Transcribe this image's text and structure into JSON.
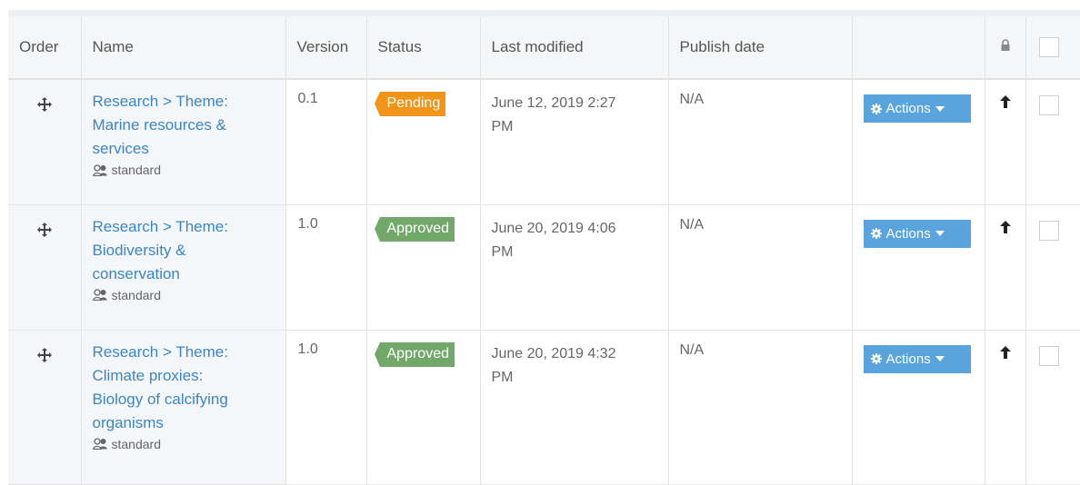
{
  "columns": {
    "order": "Order",
    "name": "Name",
    "version": "Version",
    "status": "Status",
    "last_modified": "Last modified",
    "publish_date": "Publish date"
  },
  "icons": {
    "move": "move-icon",
    "lock": "lock-icon",
    "users": "users-icon",
    "gear": "gear-icon",
    "caret": "caret-down-icon",
    "arrow_up": "arrow-up-icon"
  },
  "colors": {
    "pending": "#f0941a",
    "approved": "#72a96b",
    "action": "#5aa4de",
    "link": "#3a86c4"
  },
  "rows": [
    {
      "name_lines": [
        "Research > Theme:",
        "Marine resources &",
        "services"
      ],
      "template": "standard",
      "version": "0.1",
      "status": "Pending",
      "last_modified_lines": [
        "June 12, 2019 2:27",
        "PM"
      ],
      "publish_date": "N/A",
      "actions_label": "Actions"
    },
    {
      "name_lines": [
        "Research > Theme:",
        "Biodiversity &",
        "conservation"
      ],
      "template": "standard",
      "version": "1.0",
      "status": "Approved",
      "last_modified_lines": [
        "June 20, 2019 4:06",
        "PM"
      ],
      "publish_date": "N/A",
      "actions_label": "Actions"
    },
    {
      "name_lines": [
        "Research > Theme:",
        "Climate proxies:",
        "Biology of calcifying",
        "organisms"
      ],
      "template": "standard",
      "version": "1.0",
      "status": "Approved",
      "last_modified_lines": [
        "June 20, 2019 4:32",
        "PM"
      ],
      "publish_date": "N/A",
      "actions_label": "Actions"
    }
  ]
}
